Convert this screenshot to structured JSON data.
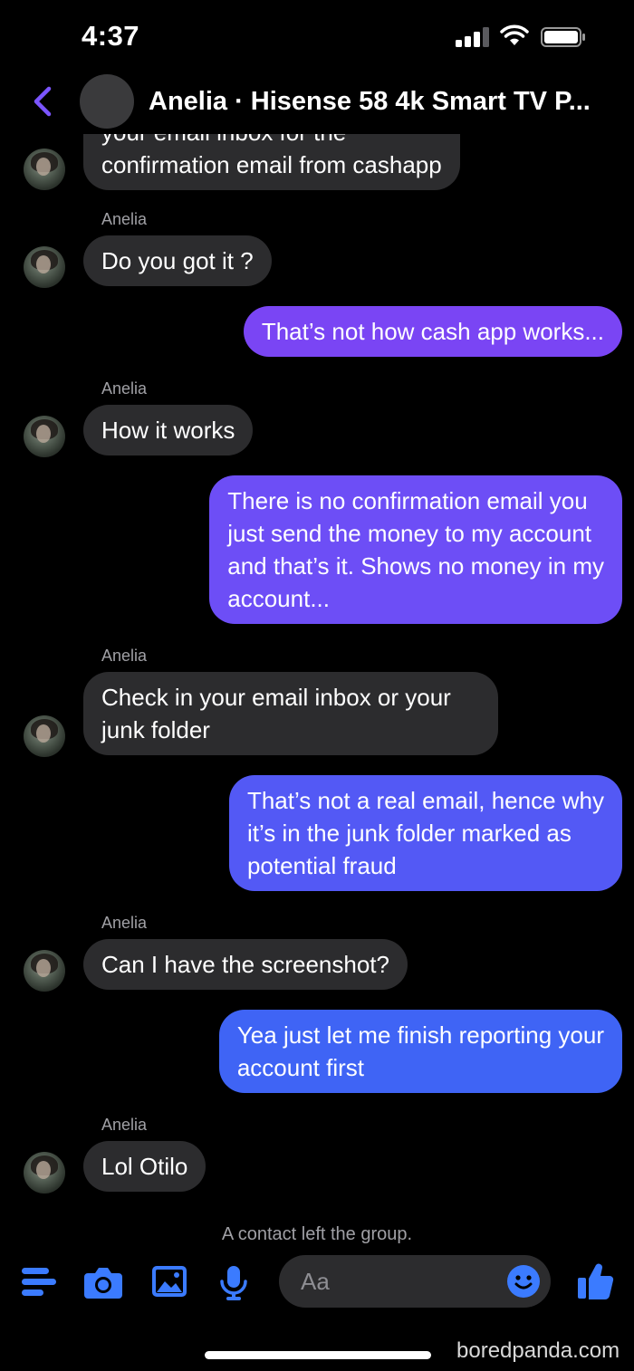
{
  "status": {
    "time": "4:37"
  },
  "header": {
    "title": "Anelia · Hisense 58 4k Smart TV P..."
  },
  "messages": {
    "m0_line1": "your email inbox for the",
    "m0_line2": "confirmation email from cashapp",
    "sender_name": "Anelia",
    "m1": "Do you got it ?",
    "m2": "That’s not how cash app works...",
    "m3": "How it works",
    "m4_l1": "There is no confirmation email you",
    "m4_l2": "just send the money to my account",
    "m4_l3": "and that’s it. Shows no money in my",
    "m4_l4": "account...",
    "m5_l1": "Check in your email inbox or your",
    "m5_l2": "junk folder",
    "m6_l1": "That’s not a real email, hence why",
    "m6_l2": "it’s in the junk folder marked as",
    "m6_l3": "potential fraud",
    "m7": "Can I have the screenshot?",
    "m8_l1": "Yea just let me finish reporting your",
    "m8_l2": "account first",
    "m9": "Lol Otilo",
    "system_note": "A contact left the group."
  },
  "composer": {
    "placeholder": "Aa",
    "icons": [
      "menu-icon",
      "camera-icon",
      "gallery-icon",
      "microphone-icon",
      "emoji-icon",
      "thumbs-up-icon"
    ]
  },
  "watermark": "boredpanda.com",
  "colors": {
    "accent": "#7b55ff",
    "outgoing_top": "#8a3ff0",
    "outgoing_bottom": "#3d63f5",
    "incoming": "#2c2c2e",
    "icon_blue": "#3b7bff"
  }
}
